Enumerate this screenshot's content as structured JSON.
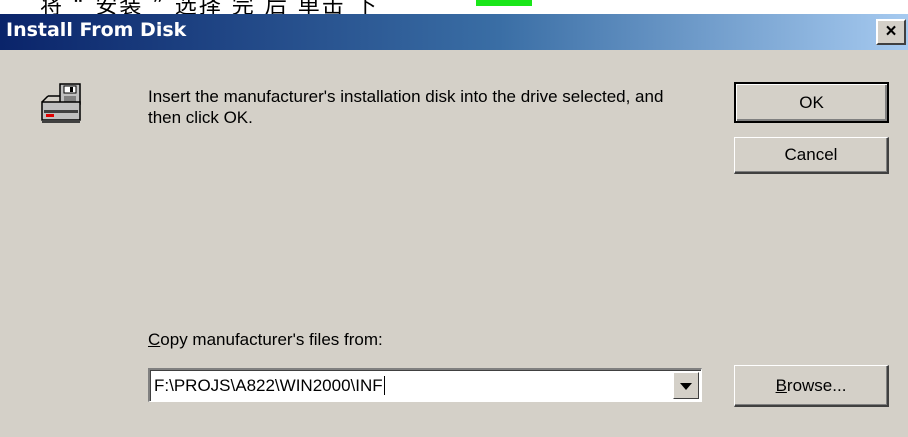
{
  "caption": {
    "text": "将 “ 安装 ” 选择 完 后 单击 下 ",
    "highlight_color": "#19e619"
  },
  "window": {
    "title": "Install From Disk",
    "close_glyph": "×"
  },
  "dialog": {
    "instruction": "Insert the manufacturer's installation disk into the drive selected, and then click OK.",
    "ok_label": "OK",
    "cancel_label": "Cancel",
    "copy_label_accel": "C",
    "copy_label_rest": "opy manufacturer's files from:",
    "path_value": "F:\\PROJS\\A822\\WIN2000\\INF",
    "browse_accel": "B",
    "browse_rest": "rowse..."
  },
  "icons": {
    "disk": "floppy-disk-drive-icon",
    "dropdown": "chevron-down-icon"
  },
  "colors": {
    "title_gradient_start": "#0a246a",
    "title_gradient_end": "#a6caf0",
    "dialog_bg": "#d4d0c8"
  }
}
